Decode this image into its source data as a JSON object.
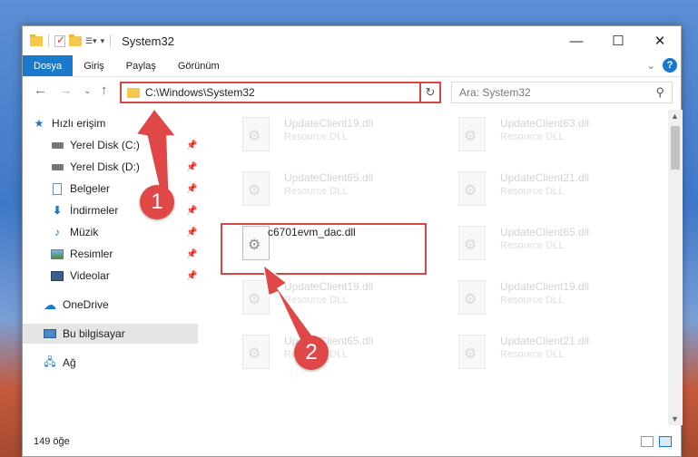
{
  "window": {
    "title": "System32",
    "minimize_icon": "minimize-icon",
    "maximize_icon": "maximize-icon",
    "close_icon": "close-icon"
  },
  "ribbon": {
    "tabs": [
      "Dosya",
      "Giriş",
      "Paylaş",
      "Görünüm"
    ],
    "active_color": "#1979ca"
  },
  "address": {
    "path": "C:\\Windows\\System32",
    "search_placeholder": "Ara: System32"
  },
  "sidebar": {
    "items": [
      {
        "label": "Hızlı erişim",
        "icon": "star-icon",
        "pinned": false
      },
      {
        "label": "Yerel Disk (C:)",
        "icon": "drive-icon",
        "pinned": true
      },
      {
        "label": "Yerel Disk (D:)",
        "icon": "drive-icon",
        "pinned": true
      },
      {
        "label": "Belgeler",
        "icon": "documents-icon",
        "pinned": true
      },
      {
        "label": "İndirmeler",
        "icon": "download-icon",
        "pinned": true
      },
      {
        "label": "Müzik",
        "icon": "music-icon",
        "pinned": true
      },
      {
        "label": "Resimler",
        "icon": "pictures-icon",
        "pinned": true
      },
      {
        "label": "Videolar",
        "icon": "videos-icon",
        "pinned": true
      },
      {
        "label": "OneDrive",
        "icon": "cloud-icon",
        "pinned": false
      },
      {
        "label": "Bu bilgisayar",
        "icon": "computer-icon",
        "pinned": false
      },
      {
        "label": "Ağ",
        "icon": "network-icon",
        "pinned": false
      }
    ]
  },
  "files": [
    {
      "name": "UpdateClient19.dll",
      "type": "Resource DLL"
    },
    {
      "name": "UpdateClient63.dll",
      "type": "Resource DLL"
    },
    {
      "name": "UpdateClient65.dll",
      "type": "Resource DLL"
    },
    {
      "name": "UpdateClient21.dll",
      "type": "Resource DLL"
    },
    {
      "name": "c6701evm_dac.dll",
      "type": ""
    },
    {
      "name": "UpdateClient65.dll",
      "type": "Resource DLL"
    },
    {
      "name": "UpdateClient19.dll",
      "type": "Resource DLL"
    },
    {
      "name": "UpdateClient19.dll",
      "type": "Resource DLL"
    },
    {
      "name": "UpdateClient65.dll",
      "type": "Resource DLL"
    },
    {
      "name": "UpdateClient21.dll",
      "type": "Resource DLL"
    }
  ],
  "status": {
    "count": "149 öğe"
  },
  "annotations": {
    "step1": "1",
    "step2": "2",
    "color": "#e04848"
  }
}
